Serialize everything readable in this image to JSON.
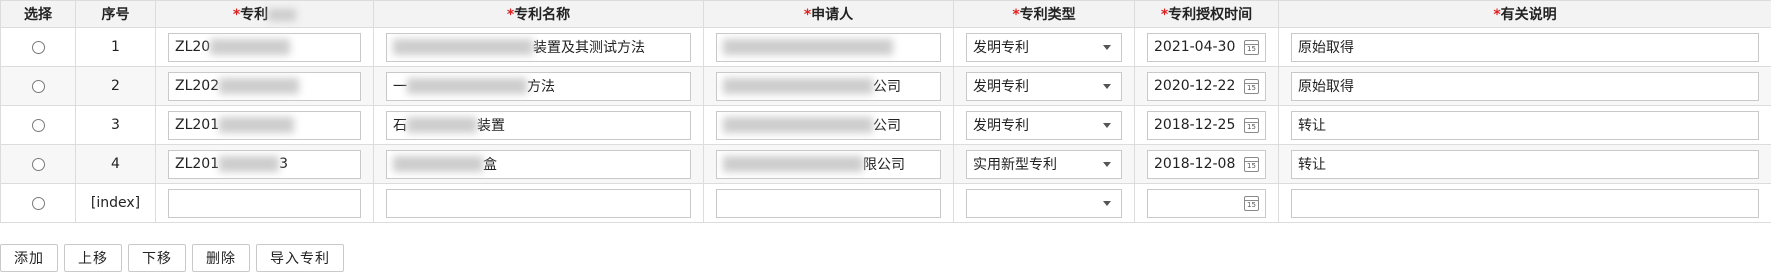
{
  "table": {
    "headers": {
      "select": "选择",
      "index": "序号",
      "patent_no": "专利",
      "patent_name": "专利名称",
      "applicant": "申请人",
      "patent_type": "专利类型",
      "grant_date": "专利授权时间",
      "remark": "有关说明"
    },
    "required_mark": "*",
    "rows": [
      {
        "index": "1",
        "patent_no": "ZL20",
        "name_prefix": "",
        "name_suffix": "装置及其测试方法",
        "applicant_suffix": "",
        "type": "发明专利",
        "date": "2021-04-30",
        "remark": "原始取得"
      },
      {
        "index": "2",
        "patent_no": "ZL202",
        "name_prefix": "一",
        "name_suffix": "方法",
        "applicant_suffix": "公司",
        "type": "发明专利",
        "date": "2020-12-22",
        "remark": "原始取得"
      },
      {
        "index": "3",
        "patent_no": "ZL201",
        "name_prefix": "石",
        "name_suffix": "装置",
        "applicant_suffix": "公司",
        "type": "发明专利",
        "date": "2018-12-25",
        "remark": "转让"
      },
      {
        "index": "4",
        "patent_no": "ZL201",
        "patent_no_tail": "3",
        "name_prefix": "",
        "name_suffix": "盒",
        "applicant_suffix": "限公司",
        "type": "实用新型专利",
        "date": "2018-12-08",
        "remark": "转让"
      }
    ],
    "template_row": {
      "index": "[index]"
    }
  },
  "calendar_icon_text": "15",
  "toolbar": {
    "add": "添加",
    "up": "上移",
    "down": "下移",
    "delete": "删除",
    "import": "导入专利"
  }
}
